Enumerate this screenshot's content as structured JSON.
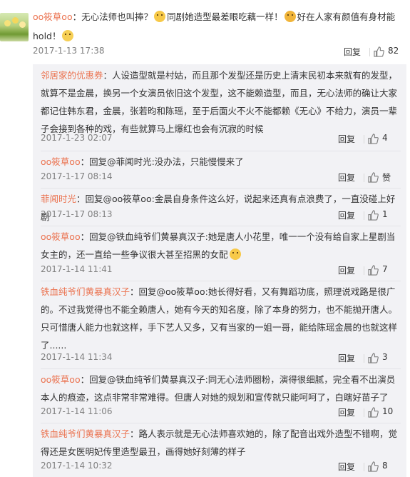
{
  "main": {
    "user": "oo筱草oo",
    "text_a": "：无心法师也叫捧？",
    "text_b": "同剧她造型最差眼吃藕一样！",
    "text_c": "好在人家有颜值有身材能hold！",
    "time": "2017-1-13 17:38",
    "reply_label": "回复",
    "likes": "82",
    "emoji_1": "hug-emoji",
    "emoji_2": "doge-emoji",
    "emoji_3": "hmm-emoji"
  },
  "replies": [
    {
      "user": "邻居家的优惠券",
      "text": "：人设造型就是村姑，而且那个发型还是历史上清末民初本来就有的发型，就算不是金晨，换另一个女演员依旧这个发型，这不能赖造型，而且，无心法师的确让大家都记住韩东君，金晨，张若昀和陈瑶，至于后面火不火不能都赖《无心》不给力，演员一辈子会接到各种的戏，有些就算马上爆红也会有沉寂的时候",
      "time": "2017-1-23 02:07",
      "reply_label": "回复",
      "likes": "4"
    },
    {
      "user": "oo筱草oo",
      "text": "：回复@菲闻时光:没办法，只能慢慢来了",
      "time": "2017-1-17 08:14",
      "reply_label": "回复",
      "likes": "赞"
    },
    {
      "user": "菲闻时光",
      "text": "：回复@oo筱草oo:金晨自身条件这么好，说起来还真有点浪费了，一直没碰上好剧",
      "time": "2017-1-17 08:13",
      "reply_label": "回复",
      "likes": "1"
    },
    {
      "user": "oo筱草oo",
      "text": "：回复@铁血纯爷们黄暴真汉子:她是唐人小花里，唯一一个没有给自家上星剧当女主的，还一直给一些争议很大甚至招黑的女配",
      "time": "2017-1-14 11:41",
      "reply_label": "回复",
      "likes": "7"
    },
    {
      "user": "铁血纯爷们黄暴真汉子",
      "text": "：回复@oo筱草oo:她长得好看，又有舞蹈功底，照理说戏路是很广的。不过我觉得也不能全赖唐人，她有今天的知名度，除了本身的努力，也不能抛开唐人。只可惜唐人能力也就这样，手下艺人又多，又有当家的一姐一哥，能给陈瑶金晨的也就这样了......",
      "time": "2017-1-14 11:34",
      "reply_label": "回复",
      "likes": "3"
    },
    {
      "user": "oo筱草oo",
      "text": "：回复@铁血纯爷们黄暴真汉子:同无心法师圈粉，演得很细腻，完全看不出演员本人的痕迹，这点非常非常难得。但唐人对她的规划和宣传就只能呵呵了，白瞎好苗子了",
      "time": "2017-1-14 11:06",
      "reply_label": "回复",
      "likes": "10"
    },
    {
      "user": "铁血纯爷们黄暴真汉子",
      "text": "：路人表示就是无心法师喜欢她的，除了配音出戏外造型不错啊，觉得还是女医明妃传里造型最丑，画得她好刻薄的样子",
      "time": "2017-1-14 10:32",
      "reply_label": "回复",
      "likes": "8"
    }
  ]
}
